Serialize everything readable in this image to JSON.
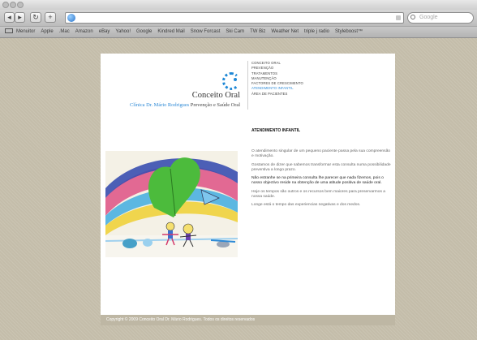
{
  "browser": {
    "back_label": "◂",
    "forward_label": "▸",
    "reload_label": "↻",
    "add_label": "+",
    "search_placeholder": "Google",
    "bookmarks": [
      "Menuitor",
      "Apple",
      ".Mac",
      "Amazon",
      "eBay",
      "Yahoo!",
      "Google",
      "Kindred Mail",
      "Snow Forcast",
      "Ski Cam",
      "TW Biz",
      "Weather Net",
      "triple j radio",
      "Styleboost™"
    ]
  },
  "site": {
    "brand": "Conceito Oral",
    "clinic_name": "Clínica Dr. Mário Rodrigues",
    "slogan": "Prevenção e Saúde Oral",
    "nav": [
      {
        "label": "CONCEITO ORAL",
        "active": false
      },
      {
        "label": "PREVENÇÃO",
        "active": false
      },
      {
        "label": "TRATAMENTOS",
        "active": false
      },
      {
        "label": "MANUTENÇÃO",
        "active": false
      },
      {
        "label": "FACTORES DE CRESCIMENTO",
        "active": false
      },
      {
        "label": "ATENDIMENTO INFANTIL",
        "active": true
      },
      {
        "label": "ÁREA DE PACIENTES",
        "active": false
      }
    ],
    "section_title": "ATENDIMENTO INFANTIL",
    "paragraphs": [
      "O atendimento singular de um pequeno paciente passa pela sua compreensão e motivação.",
      "Gostamos de dizer que sabemos transformar esta consulta numa possibilidade preventiva a longo prazo.",
      "Não estranhe se na primeira consulta lhe parecer que nada fizemos, pois o nosso objectivo reside na obtenção de uma atitude positiva de saúde oral.",
      "Hoje os tempos são outros e os recursos bem maiores para preservarmos a nossa saúde.",
      "Longe está o tempo das experiencias negativas e dos medos."
    ],
    "footer": "Copyright © 2009 Conceito Oral Dr. Mário Rodrigues. Todos os direitos reservados",
    "accent_color": "#2e8ad6"
  }
}
